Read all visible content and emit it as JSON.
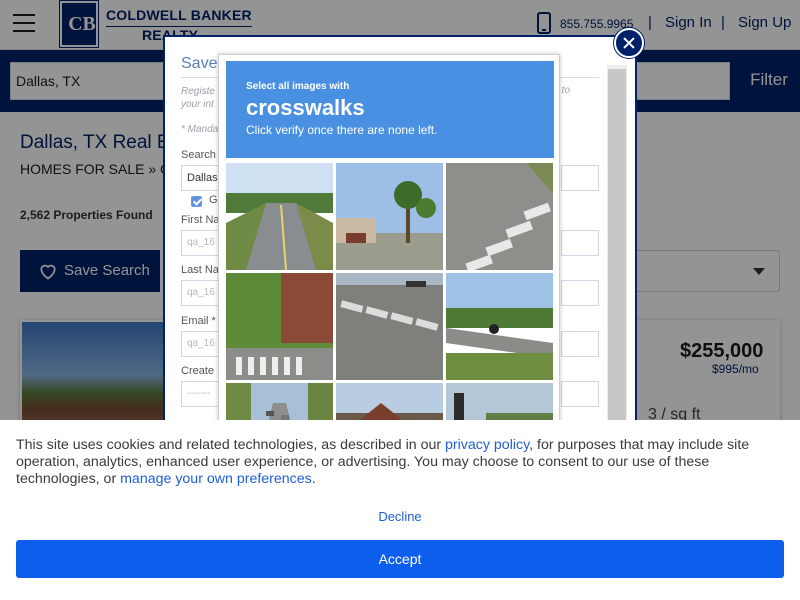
{
  "header": {
    "logo_text_line1": "COLDWELL BANKER",
    "logo_text_line2": "REALTY",
    "phone": "855.755.9965",
    "sign_in": "Sign In",
    "sign_up": "Sign Up",
    "separator": "|"
  },
  "search": {
    "value": "Dallas, TX",
    "filter_label": "Filter"
  },
  "results": {
    "title": "Dallas, TX Real E",
    "breadcrumb": "HOMES FOR SALE",
    "breadcrumb_sep": "»",
    "breadcrumb_tail": "C",
    "count": "2,562 Properties Found",
    "save_search": "Save Search"
  },
  "listing": {
    "price": "$255,000",
    "rent": "$995/mo",
    "sqft": "3 / sq ft"
  },
  "modal": {
    "title": "Save",
    "register_text_1": "Registe",
    "register_text_2": "your int",
    "register_text_right": "ght to",
    "mandatory": "* Manda",
    "search_label": "Search",
    "search_value": "Dallas",
    "checkbox_label": "Ge",
    "first_name_label": "First Na",
    "first_name_placeholder": "qa_16",
    "last_name_label": "Last Na",
    "last_name_placeholder": "qa_16",
    "email_label": "Email *",
    "email_placeholder": "qa_16",
    "create_label": "Create",
    "create_placeholder": "-------"
  },
  "captcha": {
    "instruction_small": "Select all images with",
    "target": "crosswalks",
    "instruction_sub": "Click verify once there are none left.",
    "tiles": [
      "street",
      "palm-trees",
      "crosswalk",
      "crosswalk-trees",
      "crosswalk-closeup",
      "motorcycle-road",
      "city-street",
      "houses",
      "traffic-light"
    ]
  },
  "cookie": {
    "text_1": "This site uses cookies and related technologies, as described in our ",
    "privacy_link": "privacy policy",
    "text_2": ", for purposes that may include site operation, analytics, enhanced user experience, or advertising. You may choose to consent to our use of these technologies, or ",
    "preferences_link": "manage your own preferences",
    "text_3": ".",
    "decline": "Decline",
    "accept": "Accept"
  },
  "colors": {
    "brand_navy": "#012169",
    "captcha_blue": "#4a90e2",
    "accept_blue": "#0d5eec",
    "link_blue": "#1f5fd6"
  }
}
